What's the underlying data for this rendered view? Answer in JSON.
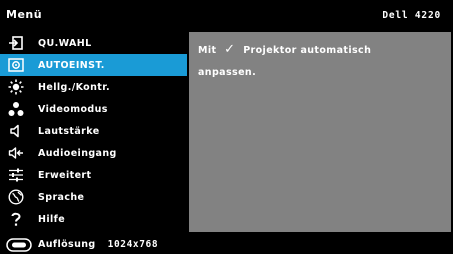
{
  "header": {
    "title": "Menü",
    "model": "Dell 4220"
  },
  "sidebar": {
    "items": [
      {
        "label": "QU.WAHL",
        "icon": "enter-icon",
        "active": false
      },
      {
        "label": "AUTOEINST.",
        "icon": "auto-adjust-icon",
        "active": true
      },
      {
        "label": "Hellg./Kontr.",
        "icon": "brightness-icon",
        "active": false
      },
      {
        "label": "Videomodus",
        "icon": "video-mode-icon",
        "active": false
      },
      {
        "label": "Lautstärke",
        "icon": "speaker-icon",
        "active": false
      },
      {
        "label": "Audioeingang",
        "icon": "audio-input-icon",
        "active": false
      },
      {
        "label": "Erweitert",
        "icon": "sliders-icon",
        "active": false
      },
      {
        "label": "Sprache",
        "icon": "language-icon",
        "active": false
      },
      {
        "label": "Hilfe",
        "icon": "help-icon",
        "active": false
      }
    ]
  },
  "panel": {
    "prefix": "Mit",
    "check_icon": "✓",
    "line1_suffix": "Projektor automatisch",
    "line2": "anpassen."
  },
  "footer": {
    "icon": "resolution-icon",
    "label": "Auflösung",
    "value": "1024x768"
  },
  "colors": {
    "background": "#000000",
    "highlight": "#1a9bd6",
    "panel": "#828282",
    "text": "#ffffff"
  }
}
